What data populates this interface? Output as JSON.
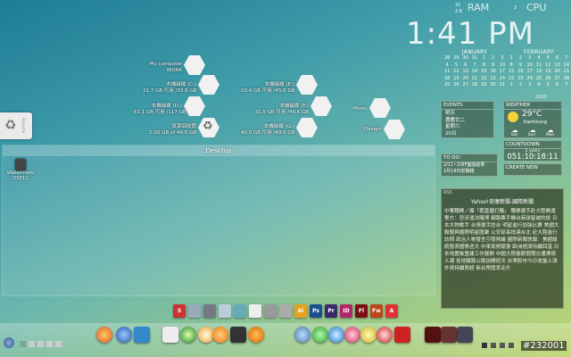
{
  "clock": {
    "time": "1:41 PM"
  },
  "meters": {
    "ram_top": "21",
    "ram_bottom": "2.6",
    "ram_label": "RAM",
    "cpu_value": "2",
    "cpu_label": "CPU"
  },
  "recycle_bin": {
    "label": "Recycle"
  },
  "drives_left": [
    {
      "l1": "My computer",
      "l2": "WORK"
    },
    {
      "l1": "本機磁碟 (C:)",
      "l2": "21.7 GB 可用 /33.8 GB"
    },
    {
      "l1": "本機磁碟 (D:)",
      "l2": "61.1 GB 可用 /117 GB"
    },
    {
      "l1": "資源回收筒",
      "l2": "1.00 GB of 49.5 GB"
    }
  ],
  "drives_right": [
    {
      "l1": "本機磁碟 (E:)",
      "l2": "20.4 GB 可用 /45.6 GB"
    },
    {
      "l1": "本機磁碟 (F:)",
      "l2": "31.5 GB 可用 /49.6 GB"
    },
    {
      "l1": "本機磁碟 (G:)",
      "l2": "40.0 GB 可用 /49.0 GB"
    }
  ],
  "media": {
    "music": "Music",
    "design": "Design"
  },
  "desktop_panel": {
    "title": "Desktop"
  },
  "desktop_icon": {
    "label": "Watermark",
    "sub": "DSP12"
  },
  "calendar": {
    "jan": {
      "title": "JANUARY",
      "days": [
        "28",
        "29",
        "30",
        "31",
        "1",
        "2",
        "3",
        "4",
        "5",
        "6",
        "7",
        "8",
        "9",
        "10",
        "11",
        "12",
        "13",
        "14",
        "15",
        "16",
        "17",
        "18",
        "19",
        "20",
        "21",
        "22",
        "23",
        "24",
        "25",
        "26",
        "27",
        "28",
        "29",
        "30",
        "31"
      ]
    },
    "feb": {
      "title": "FEBRUARY",
      "days": [
        "1",
        "2",
        "3",
        "4",
        "5",
        "6",
        "7",
        "8",
        "9",
        "10",
        "11",
        "12",
        "13",
        "14",
        "15",
        "16",
        "17",
        "18",
        "19",
        "20",
        "21",
        "22",
        "23",
        "24",
        "25",
        "26",
        "27",
        "28",
        "1",
        "2",
        "3",
        "4",
        "5",
        "6",
        "7"
      ]
    },
    "year": "2010"
  },
  "events": {
    "title": "EVENTS",
    "lines": [
      "明天",
      "農曆廿二",
      "星期六",
      "20日"
    ]
  },
  "weather": {
    "title": "WEATHER",
    "temp": "29°C",
    "place": "Kaohsiung",
    "days": [
      "Sat",
      "Sun",
      "Mon"
    ]
  },
  "countdown": {
    "title": "COUNTDOWN",
    "sub": "2 years",
    "value": "051:10:18:11"
  },
  "create_new": {
    "title": "CREATE NEW"
  },
  "todo": {
    "title": "TO DO:",
    "items": [
      "2/11~2/6F面談結果",
      "2月18日前聯絡"
    ]
  },
  "news": {
    "title": "RSS",
    "head": "Yahoo!奇摩新聞-國際新聞",
    "body": "中華職棒／爆「假直播打賭」 職棒選手赴大陸開運 警方：恐涉違法賭博 網路票手機台商球星被約談 日本大物歌手 台灣選手訪台 明星進行加強比賽 美國大聯盟與國際明星匯聚 公安部長抵達台北 赴大陸進行訪問 政治人物發言引發熱議 國際新聞快報：美國總統發表國情咨文 中東局勢緊張 歐洲經濟持續回溫 日本地震後重建工作展開 中國大陸春節假期交通湧現人潮 各地鐵路公路加開班次 台灣股市今日收盤上漲 外資持續買超 新台幣匯率走升"
  },
  "dock": [
    "S",
    "",
    "",
    "",
    "",
    "",
    "",
    "",
    "Ai",
    "Ps",
    "Pr",
    "ID",
    "Fl",
    "Fw",
    "A"
  ],
  "taskbar": {
    "watermark": "#232001"
  }
}
